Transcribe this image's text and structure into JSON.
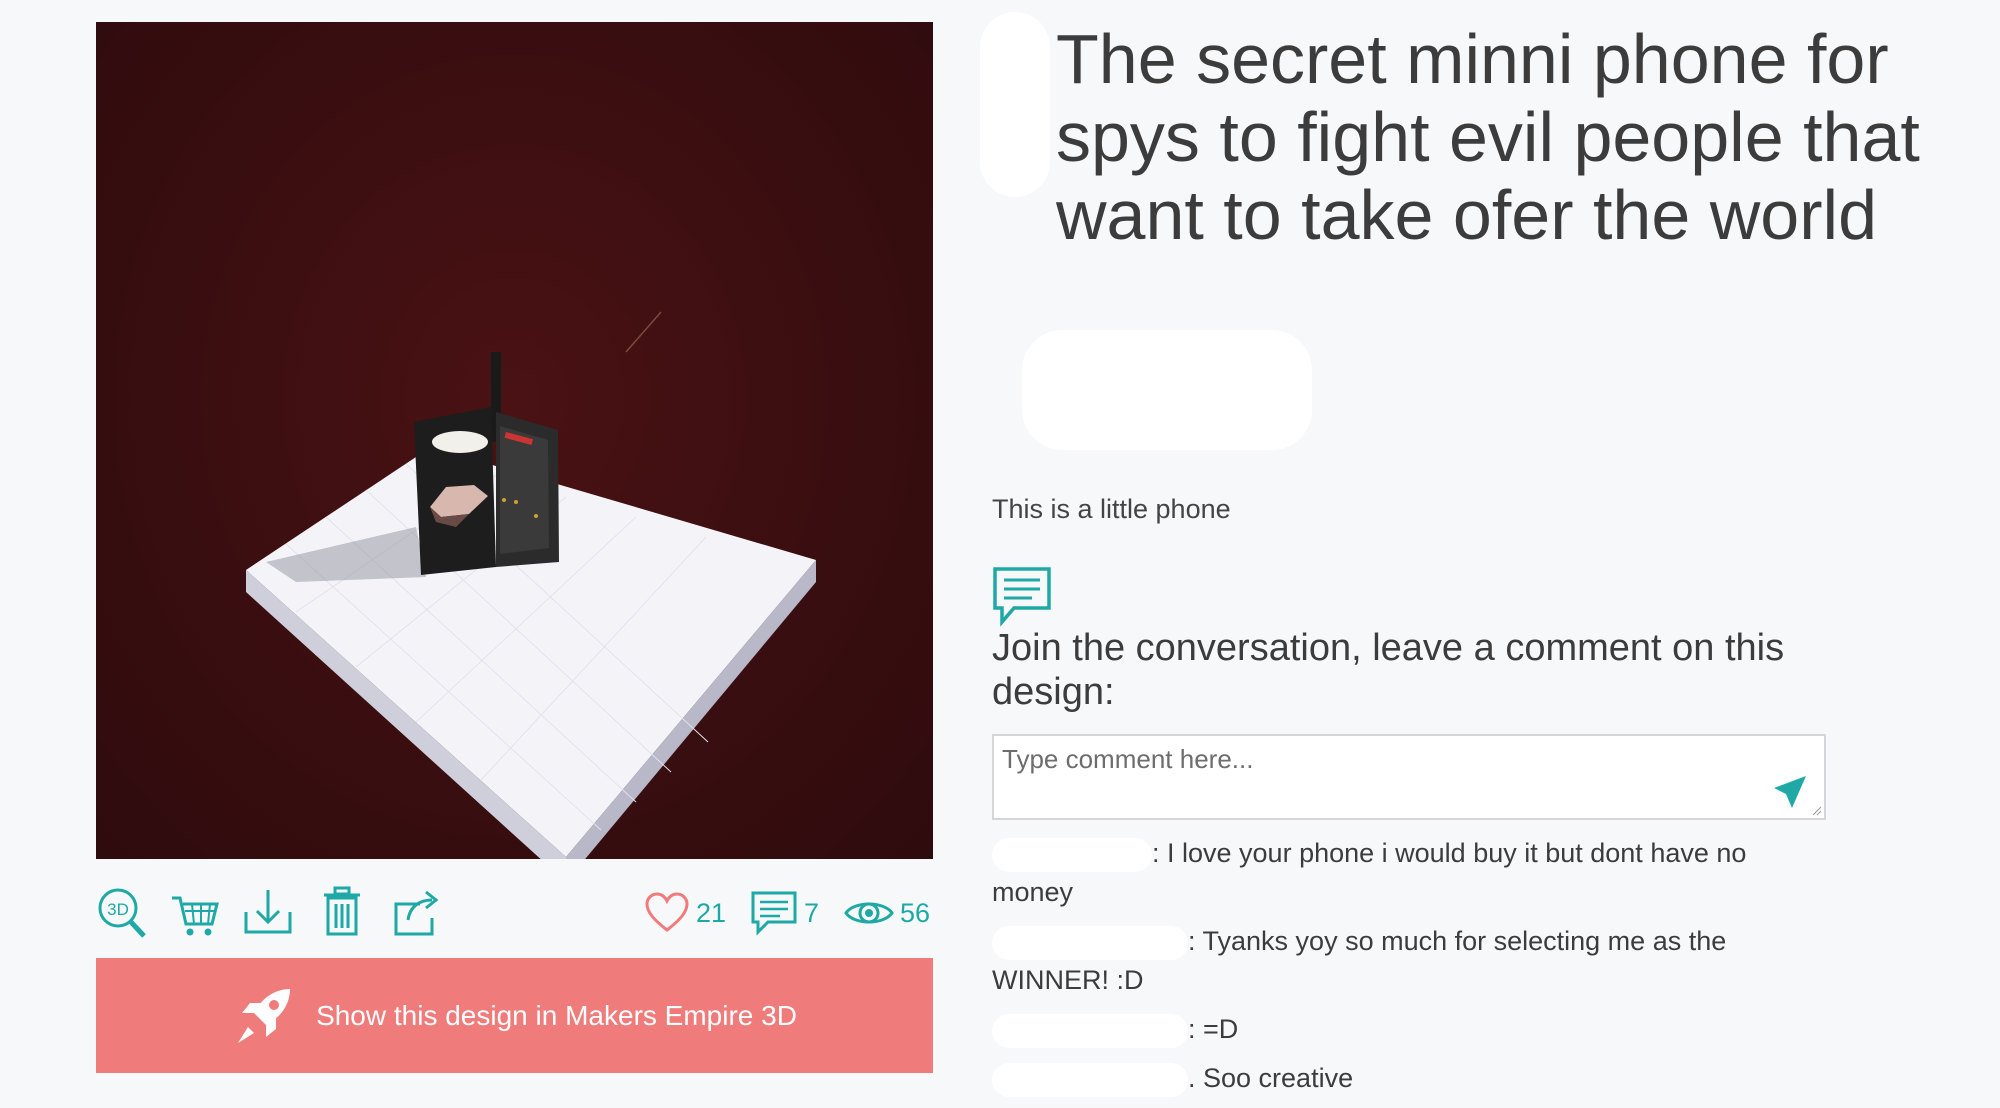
{
  "design": {
    "title": "The secret minni phone for spys to fight evil people that want to take ofer the world",
    "description": "This is a little phone"
  },
  "viewer": {
    "background_color": "#3a0e10",
    "plate_color": "#f4f4f8"
  },
  "toolbar": {
    "icons": [
      "3d-view-icon",
      "cart-icon",
      "download-icon",
      "trash-icon",
      "share-icon"
    ],
    "likes": "21",
    "comments": "7",
    "views": "56"
  },
  "cta": {
    "label": "Show this design in Makers Empire 3D",
    "color": "#f07b7b"
  },
  "conversation": {
    "prompt": "Join the conversation, leave a comment on this design:",
    "placeholder": "Type comment here..."
  },
  "comments": [
    {
      "text": ": I love your phone i would buy it but dont have no money"
    },
    {
      "text": ": Tyanks yoy so much for selecting me as the WINNER! :D"
    },
    {
      "text": ": =D"
    },
    {
      "text": ". Soo creative"
    }
  ],
  "accent_color": "#1fa9a6"
}
